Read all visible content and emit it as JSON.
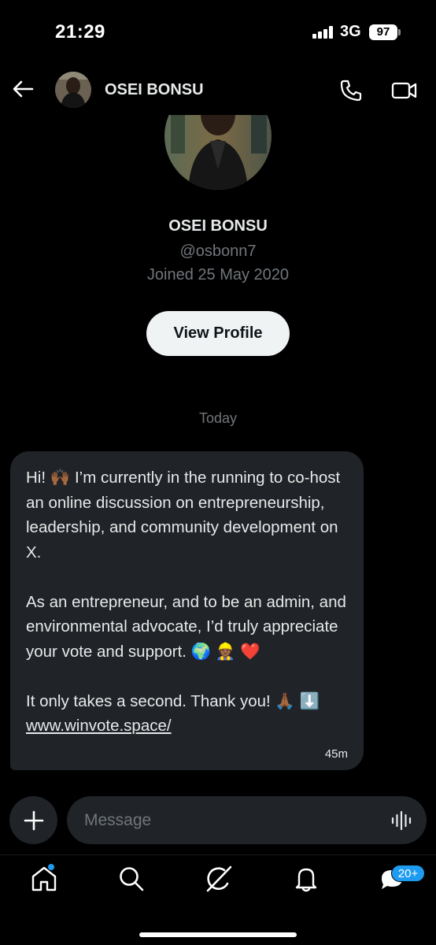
{
  "status_bar": {
    "time": "21:29",
    "network": "3G",
    "battery": "97"
  },
  "header": {
    "name": "OSEI BONSU"
  },
  "profile": {
    "name": "OSEI BONSU",
    "handle": "@osbonn7",
    "joined": "Joined 25 May 2020",
    "view_profile_label": "View Profile"
  },
  "conversation": {
    "date_divider": "Today",
    "message": {
      "paragraph_1": "Hi! 🙌🏾 I’m currently in the running to co-host an online discussion on entrepreneurship, leadership, and community development on X.",
      "paragraph_2": "As an entrepreneur, and to be an admin, and environmental advocate, I’d truly appreciate your vote and support. 🌍 👷🏾 ❤️",
      "paragraph_3": "It only takes a second. Thank you! 🙏🏾 ⬇️",
      "link": "www.winvote.space/",
      "time": "45m"
    }
  },
  "composer": {
    "placeholder": "Message"
  },
  "nav": {
    "messages_badge": "20+"
  },
  "colors": {
    "accent": "#1d9bf0",
    "bubble": "#202327",
    "muted": "#71767b",
    "background": "#000000"
  }
}
